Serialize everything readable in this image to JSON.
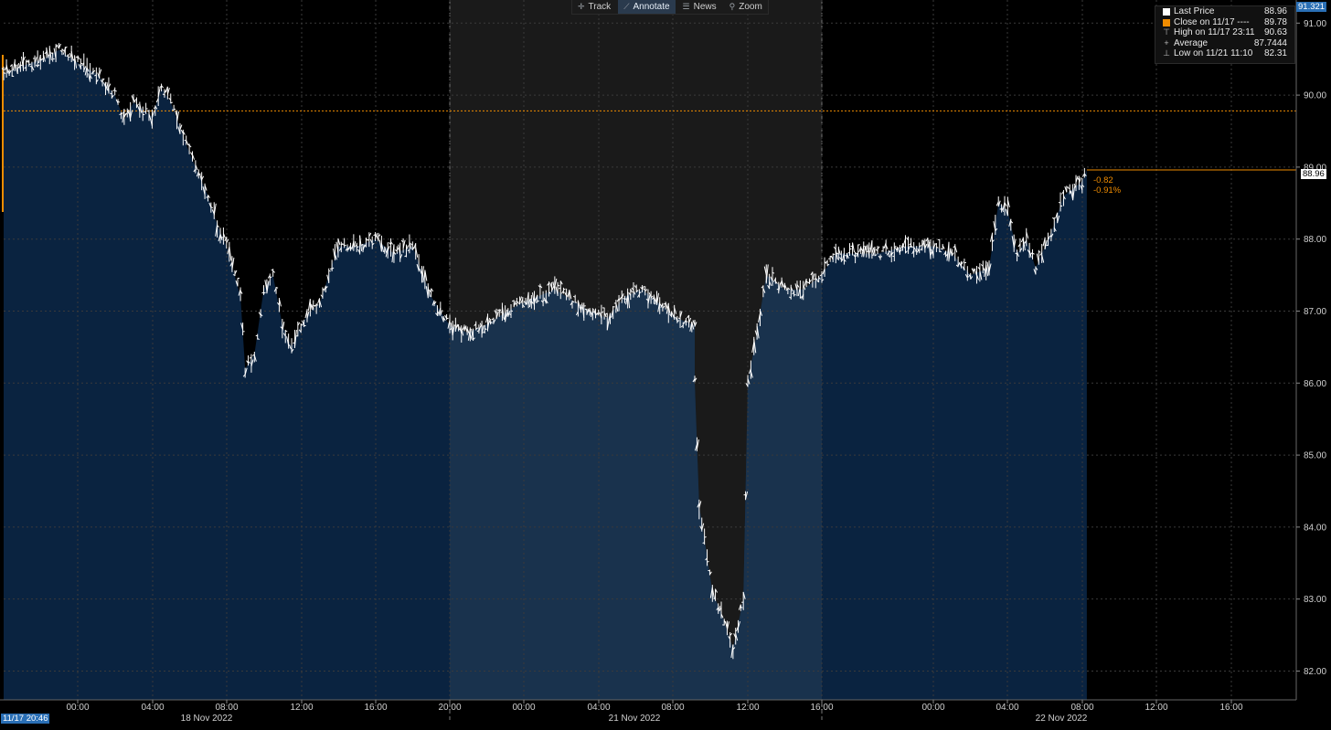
{
  "toolbar": {
    "items": [
      {
        "label": "Track",
        "icon": "crosshair-icon"
      },
      {
        "label": "Annotate",
        "icon": "pencil-icon"
      },
      {
        "label": "News",
        "icon": "news-icon"
      },
      {
        "label": "Zoom",
        "icon": "magnifier-icon"
      }
    ],
    "active": "Annotate"
  },
  "legend": {
    "last_price": {
      "label": "Last Price",
      "value": "88.96"
    },
    "close": {
      "label": "Close on 11/17 ----",
      "value": "89.78"
    },
    "high": {
      "label": "High on 11/17 23:11",
      "value": "90.63"
    },
    "average": {
      "label": "Average",
      "value": "87.7444"
    },
    "low": {
      "label": "Low on 11/21 11:10",
      "value": "82.31"
    }
  },
  "tags": {
    "top_value": "91.321",
    "last_value": "88.96",
    "change_abs": "-0.82",
    "change_pct": "-0.91%",
    "start_stamp": "11/17 20:46"
  },
  "colors": {
    "background": "#000000",
    "weekend_shade": "#1a1a1a",
    "area_fill": "#0a2340",
    "area_fill_weekend": "#19324d",
    "price_line": "#ffffff",
    "close_line": "#f08c00",
    "grid": "#3a3a3a",
    "axis_text": "#d0d0d0",
    "tag_bg": "#2a6fb5"
  },
  "chart_data": {
    "type": "area",
    "series": [
      {
        "name": "Last Price",
        "x": [
          "2022-11-17 20:46",
          "2022-11-17 21:30",
          "2022-11-17 22:30",
          "2022-11-17 23:11",
          "2022-11-18 00:00",
          "2022-11-18 01:00",
          "2022-11-18 02:00",
          "2022-11-18 02:30",
          "2022-11-18 03:00",
          "2022-11-18 04:00",
          "2022-11-18 04:30",
          "2022-11-18 05:00",
          "2022-11-18 06:00",
          "2022-11-18 06:30",
          "2022-11-18 07:00",
          "2022-11-18 07:30",
          "2022-11-18 08:00",
          "2022-11-18 08:45",
          "2022-11-18 09:00",
          "2022-11-18 09:30",
          "2022-11-18 10:00",
          "2022-11-18 10:30",
          "2022-11-18 11:00",
          "2022-11-18 11:30",
          "2022-11-18 12:00",
          "2022-11-18 12:30",
          "2022-11-18 13:00",
          "2022-11-18 14:00",
          "2022-11-18 15:00",
          "2022-11-18 16:00",
          "2022-11-18 17:00",
          "2022-11-18 18:00",
          "2022-11-18 19:00",
          "2022-11-18 20:00",
          "2022-11-18 21:00",
          "2022-11-18 22:00",
          "2022-11-19 00:00",
          "2022-11-19 02:00",
          "2022-11-19 04:00",
          "2022-11-19 05:00",
          "2022-11-19 06:00",
          "2022-11-19 07:00",
          "2022-11-19 08:00",
          "2022-11-19 09:00",
          "2022-11-19 10:00",
          "2022-11-21 09:00",
          "2022-11-21 09:15",
          "2022-11-21 10:00",
          "2022-11-21 10:30",
          "2022-11-21 11:10",
          "2022-11-21 11:45",
          "2022-11-21 12:00",
          "2022-11-21 12:30",
          "2022-11-21 13:00",
          "2022-11-21 14:00",
          "2022-11-21 15:00",
          "2022-11-21 16:00",
          "2022-11-21 17:00",
          "2022-11-21 18:00",
          "2022-11-21 20:00",
          "2022-11-21 22:00",
          "2022-11-22 00:00",
          "2022-11-22 01:00",
          "2022-11-22 02:00",
          "2022-11-22 03:00",
          "2022-11-22 03:30",
          "2022-11-22 04:00",
          "2022-11-22 04:30",
          "2022-11-22 05:00",
          "2022-11-22 05:30",
          "2022-11-22 06:00",
          "2022-11-22 06:30",
          "2022-11-22 07:00",
          "2022-11-22 08:00",
          "2022-11-22 08:15"
        ],
        "y": [
          90.3,
          90.4,
          90.5,
          90.63,
          90.45,
          90.3,
          90.0,
          89.65,
          89.9,
          89.7,
          90.1,
          89.9,
          89.2,
          88.9,
          88.6,
          88.2,
          87.9,
          87.2,
          86.2,
          86.4,
          87.3,
          87.5,
          86.8,
          86.5,
          86.8,
          87.0,
          87.1,
          87.9,
          87.9,
          88.0,
          87.8,
          87.9,
          87.2,
          86.8,
          86.7,
          86.8,
          87.1,
          87.3,
          87.0,
          86.9,
          87.2,
          87.3,
          87.1,
          86.9,
          86.8,
          86.0,
          84.3,
          83.1,
          82.8,
          82.31,
          83.0,
          86.0,
          86.7,
          87.5,
          87.3,
          87.3,
          87.5,
          87.8,
          87.8,
          87.8,
          87.9,
          87.9,
          87.8,
          87.5,
          87.6,
          88.5,
          88.4,
          87.8,
          88.0,
          87.6,
          87.9,
          88.2,
          88.6,
          88.8,
          88.96
        ]
      }
    ],
    "reference_lines": [
      {
        "name": "Close on 11/17",
        "value": 89.78
      }
    ],
    "sessions_shaded": [
      [
        "2022-11-18 20:00",
        "2022-11-21 16:00"
      ]
    ],
    "ylim": [
      81.6,
      91.321
    ],
    "y_ticks": [
      82.0,
      83.0,
      84.0,
      85.0,
      86.0,
      87.0,
      88.0,
      89.0,
      90.0,
      91.0
    ],
    "x_tick_labels": [
      "00:00",
      "04:00",
      "08:00",
      "12:00",
      "16:00",
      "20:00",
      "00:00",
      "04:00",
      "08:00",
      "12:00",
      "16:00",
      "00:00",
      "04:00",
      "08:00",
      "12:00",
      "16:00"
    ],
    "date_labels": [
      "18 Nov 2022",
      "21 Nov 2022",
      "22 Nov 2022"
    ],
    "grid": true,
    "legend_position": "top-right"
  }
}
